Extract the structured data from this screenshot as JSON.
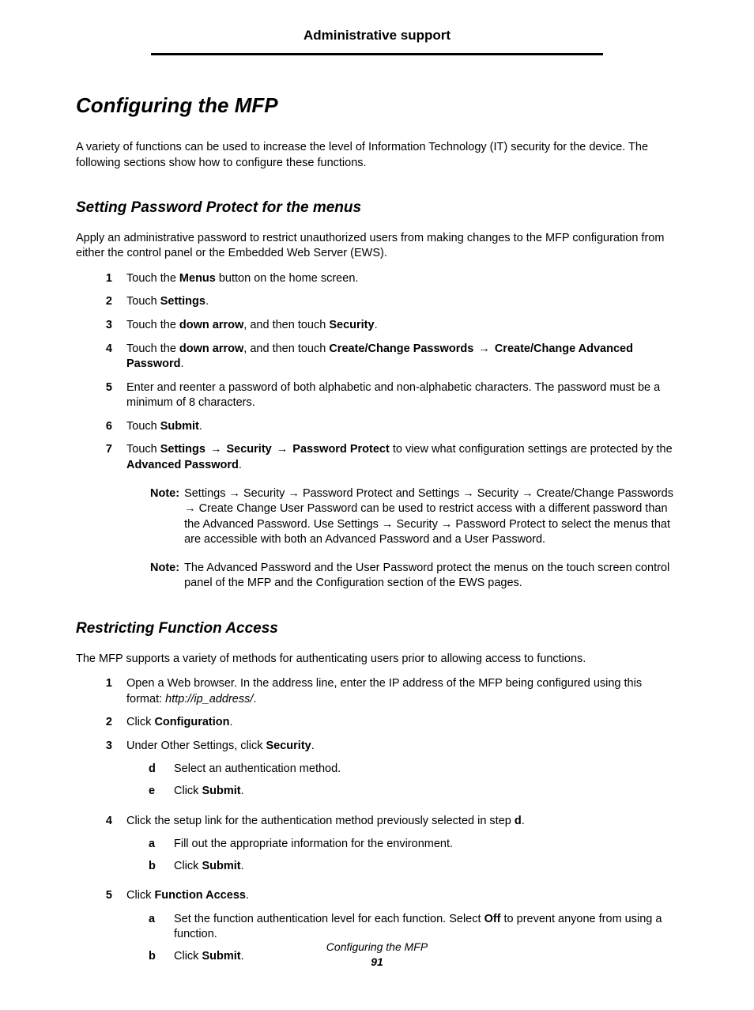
{
  "header": {
    "section": "Administrative support"
  },
  "h1": "Configuring the MFP",
  "intro": "A variety of functions can be used to increase the level of Information Technology (IT) security for the device. The following sections show how to configure these functions.",
  "secA": {
    "title": "Setting Password Protect for the menus",
    "intro": "Apply an administrative password to restrict unauthorized users from making changes to the MFP configuration from either the control panel or the Embedded Web Server (EWS).",
    "steps": {
      "s1": {
        "pre": "Touch the ",
        "b1": "Menus",
        "post": " button on the home screen."
      },
      "s2": {
        "pre": "Touch ",
        "b1": "Settings",
        "post": "."
      },
      "s3": {
        "pre": "Touch the ",
        "b1": "down arrow",
        "mid": ", and then touch ",
        "b2": "Security",
        "post": "."
      },
      "s4": {
        "pre": "Touch the ",
        "b1": "down arrow",
        "mid": ", and then touch ",
        "b2": "Create/Change Passwords",
        "arrow": " →  ",
        "b3": "Create/Change Advanced Password",
        "post": "."
      },
      "s5": {
        "text": "Enter and reenter a password of both alphabetic and non-alphabetic characters. The password must be a minimum of 8 characters."
      },
      "s6": {
        "pre": "Touch ",
        "b1": "Submit",
        "post": "."
      },
      "s7": {
        "pre": "Touch ",
        "b1": "Settings",
        "a1": " →  ",
        "b2": "Security",
        "a2": " →  ",
        "b3": "Password Protect",
        "mid": " to view what configuration settings are protected by the ",
        "b4": "Advanced Password",
        "post": "."
      }
    },
    "notes": {
      "label": "Note:",
      "n1": "Settings →  Security →  Password Protect and Settings →  Security →  Create/Change Passwords →  Create Change User Password can be used to restrict access with a different password than the Advanced Password. Use Settings →  Security →  Password Protect to select the menus that are accessible with both an Advanced Password and a User Password.",
      "n2": "The Advanced Password and the User Password protect the menus on the touch screen control panel of the MFP and the Configuration section of the EWS pages."
    }
  },
  "secB": {
    "title": "Restricting Function Access",
    "intro": "The MFP supports a variety of methods for authenticating users prior to allowing access to functions.",
    "steps": {
      "s1": {
        "text": "Open a Web browser. In the address line, enter the IP address of the MFP being configured using this format: ",
        "ital": "http://ip_address/",
        "post": "."
      },
      "s2": {
        "pre": "Click ",
        "b1": "Configuration",
        "post": "."
      },
      "s3": {
        "pre": "Under Other Settings, click ",
        "b1": "Security",
        "post": ".",
        "sub": {
          "d": {
            "text": "Select an authentication method."
          },
          "e": {
            "pre": "Click ",
            "b1": "Submit",
            "post": "."
          }
        }
      },
      "s4": {
        "pre": "Click the setup link for the authentication method previously selected in step ",
        "b1": "d",
        "post": ".",
        "sub": {
          "a": {
            "text": "Fill out the appropriate information for the environment."
          },
          "b": {
            "pre": "Click ",
            "b1": "Submit",
            "post": "."
          }
        }
      },
      "s5": {
        "pre": "Click ",
        "b1": "Function Access",
        "post": ".",
        "sub": {
          "a": {
            "pre": "Set the function authentication level for each function. Select ",
            "b1": "Off",
            "post": " to prevent anyone from using a function."
          },
          "b": {
            "pre": "Click ",
            "b1": "Submit",
            "post": "."
          }
        }
      }
    }
  },
  "footer": {
    "title": "Configuring the MFP",
    "page": "91"
  },
  "nums": {
    "n1": "1",
    "n2": "2",
    "n3": "3",
    "n4": "4",
    "n5": "5",
    "n6": "6",
    "n7": "7"
  },
  "lets": {
    "a": "a",
    "b": "b",
    "d": "d",
    "e": "e"
  }
}
